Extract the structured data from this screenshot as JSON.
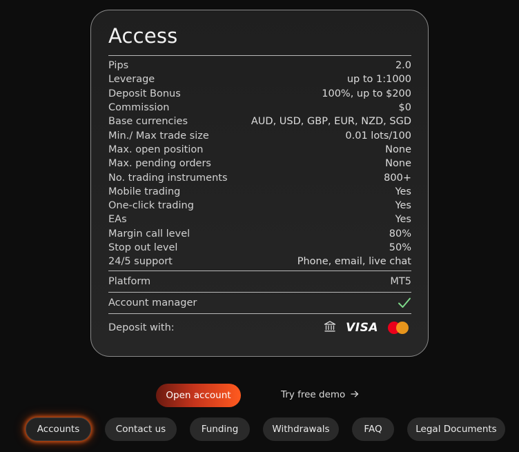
{
  "card": {
    "title": "Access",
    "specs": [
      {
        "label": "Pips",
        "value": "2.0"
      },
      {
        "label": "Leverage",
        "value": "up to 1:1000"
      },
      {
        "label": "Deposit Bonus",
        "value": "100%, up to $200"
      },
      {
        "label": "Commission",
        "value": "$0"
      },
      {
        "label": "Base currencies",
        "value": "AUD, USD, GBP, EUR, NZD, SGD"
      },
      {
        "label": "Min./ Max trade size",
        "value": "0.01 lots/100"
      },
      {
        "label": "Max. open position",
        "value": "None"
      },
      {
        "label": "Max. pending orders",
        "value": "None"
      },
      {
        "label": "No. trading instruments",
        "value": "800+"
      },
      {
        "label": "Mobile trading",
        "value": "Yes"
      },
      {
        "label": "One-click trading",
        "value": "Yes"
      },
      {
        "label": "EAs",
        "value": "Yes"
      },
      {
        "label": "Margin call level",
        "value": "80%"
      },
      {
        "label": "Stop out level",
        "value": "50%"
      },
      {
        "label": "24/5 support",
        "value": "Phone, email, live chat"
      }
    ],
    "platform": {
      "label": "Platform",
      "value": "MT5"
    },
    "account_manager": {
      "label": "Account manager",
      "icon": "check-icon",
      "icon_color": "#7ed98a"
    },
    "deposit": {
      "label": "Deposit with:",
      "methods": {
        "bank_icon": "bank-icon",
        "visa": "VISA",
        "mastercard_icon": "mastercard-icon"
      }
    }
  },
  "cta": {
    "open_account": "Open account",
    "demo": "Try free demo",
    "demo_icon": "arrow-right-icon",
    "accent": "#ff5a1f"
  },
  "nav": [
    {
      "label": "Accounts",
      "active": true
    },
    {
      "label": "Contact us",
      "active": false
    },
    {
      "label": "Funding",
      "active": false
    },
    {
      "label": "Withdrawals",
      "active": false
    },
    {
      "label": "FAQ",
      "active": false
    },
    {
      "label": "Legal Documents",
      "active": false
    }
  ]
}
